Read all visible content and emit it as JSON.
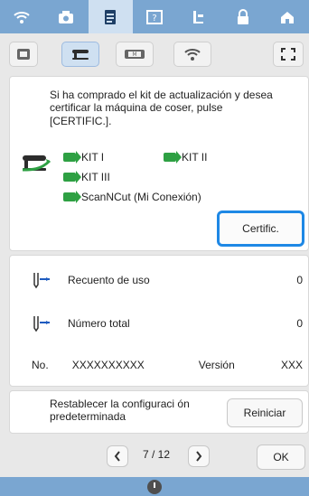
{
  "header": {
    "tabs": [
      {
        "name": "wifi-tab"
      },
      {
        "name": "camera-tab"
      },
      {
        "name": "document-tab"
      },
      {
        "name": "question-tab"
      },
      {
        "name": "sensor-tab"
      },
      {
        "name": "lock-tab"
      },
      {
        "name": "home-tab"
      }
    ]
  },
  "subheader": {
    "tabs": [
      {
        "name": "frame-tab"
      },
      {
        "name": "sewing-machine-tab"
      },
      {
        "name": "embroidery-tab"
      },
      {
        "name": "wifi-tab"
      },
      {
        "name": "fullscreen-tab"
      }
    ]
  },
  "certify_panel": {
    "description": "Si ha comprado el kit de actualización y desea certificar la máquina de coser, pulse [CERTIFIC.].",
    "kits": [
      "KIT I",
      "KIT II",
      "KIT III",
      "ScanNCut (Mi Conexión)"
    ],
    "certify_button": "Certific."
  },
  "info_panel": {
    "usage_label": "Recuento de uso",
    "usage_value": "0",
    "total_label": "Número total",
    "total_value": "0",
    "no_label": "No.",
    "no_value": "XXXXXXXXXX",
    "version_label": "Versión",
    "version_value": "XXX"
  },
  "reset_panel": {
    "text": "Restablecer la configuraci ón predeterminada",
    "button": "Reiniciar"
  },
  "pager": {
    "text": "7 / 12",
    "ok": "OK"
  }
}
